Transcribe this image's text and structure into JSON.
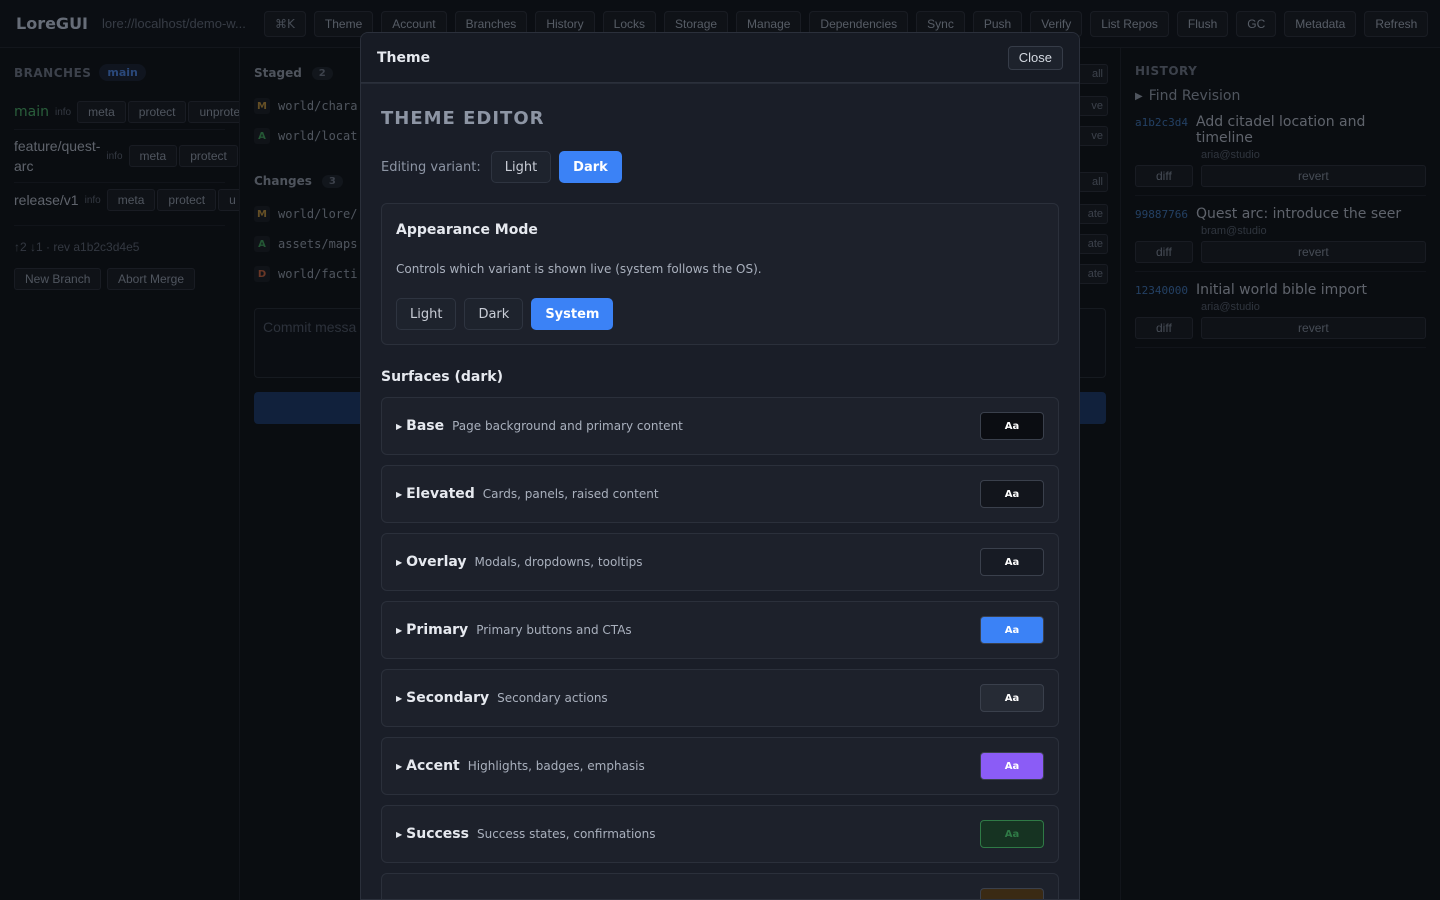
{
  "app": {
    "brand": "LoreGUI",
    "url": "lore://localhost/demo-w..."
  },
  "toolbar": {
    "kbd": "⌘K",
    "buttons": [
      "Theme",
      "Account",
      "Branches",
      "History",
      "Locks",
      "Storage",
      "Manage",
      "Dependencies",
      "Sync",
      "Push",
      "Verify",
      "List Repos",
      "Flush",
      "GC",
      "Metadata",
      "Refresh"
    ]
  },
  "branches": {
    "title": "BRANCHES",
    "current": "main",
    "info_label": "info",
    "items": [
      {
        "name": "main",
        "actions": [
          "meta",
          "protect",
          "unprote"
        ]
      },
      {
        "name": "feature/quest-arc",
        "actions": [
          "meta",
          "protect"
        ]
      },
      {
        "name": "release/v1",
        "actions": [
          "meta",
          "protect",
          "u"
        ]
      }
    ],
    "status": "↑2 ↓1 · rev a1b2c3d4e5",
    "new_branch": "New Branch",
    "abort_merge": "Abort Merge"
  },
  "staged": {
    "title": "Staged",
    "count": "2",
    "bulk": "all",
    "files": [
      {
        "status": "M",
        "path": "world/chara",
        "action": "ve"
      },
      {
        "status": "A",
        "path": "world/locat",
        "action": "ve"
      }
    ]
  },
  "changes": {
    "title": "Changes",
    "count": "3",
    "bulk": "all",
    "files": [
      {
        "status": "M",
        "path": "world/lore/",
        "action": "ate"
      },
      {
        "status": "A",
        "path": "assets/maps",
        "action": "ate"
      },
      {
        "status": "D",
        "path": "world/facti",
        "action": "ate"
      }
    ]
  },
  "commit": {
    "placeholder": "Commit messa"
  },
  "history": {
    "title": "HISTORY",
    "find": "Find Revision",
    "diff_label": "diff",
    "revert_label": "revert",
    "items": [
      {
        "hash": "a1b2c3d4",
        "message": "Add citadel location and timeline",
        "author": "aria@studio"
      },
      {
        "hash": "99887766",
        "message": "Quest arc: introduce the seer",
        "author": "bram@studio"
      },
      {
        "hash": "12340000",
        "message": "Initial world bible import",
        "author": "aria@studio"
      }
    ]
  },
  "modal": {
    "title": "Theme",
    "close": "Close",
    "editor_title": "THEME EDITOR",
    "variant_label": "Editing variant:",
    "variants": [
      "Light",
      "Dark"
    ],
    "variant_selected": "Dark",
    "appearance": {
      "title": "Appearance Mode",
      "description": "Controls which variant is shown live (system follows the OS).",
      "options": [
        "Light",
        "Dark",
        "System"
      ],
      "selected": "System"
    },
    "surfaces_title": "Surfaces (dark)",
    "surfaces": [
      {
        "name": "Base",
        "desc": "Page background and primary content",
        "sample": "Aa",
        "bg": "#0b0d12",
        "fg": "#ffffff"
      },
      {
        "name": "Elevated",
        "desc": "Cards, panels, raised content",
        "sample": "Aa",
        "bg": "#12151c",
        "fg": "#ffffff"
      },
      {
        "name": "Overlay",
        "desc": "Modals, dropdowns, tooltips",
        "sample": "Aa",
        "bg": "#171b24",
        "fg": "#ffffff"
      },
      {
        "name": "Primary",
        "desc": "Primary buttons and CTAs",
        "sample": "Aa",
        "bg": "#3b82f6",
        "fg": "#ffffff"
      },
      {
        "name": "Secondary",
        "desc": "Secondary actions",
        "sample": "Aa",
        "bg": "#262b35",
        "fg": "#ffffff"
      },
      {
        "name": "Accent",
        "desc": "Highlights, badges, emphasis",
        "sample": "Aa",
        "bg": "#8b5cf6",
        "fg": "#ffffff"
      },
      {
        "name": "Success",
        "desc": "Success states, confirmations",
        "sample": "Aa",
        "bg": "#163322",
        "fg": "#2f7a46"
      },
      {
        "name": "",
        "desc": "",
        "sample": "",
        "bg": "#3a2a14",
        "fg": "#c08a3c"
      }
    ]
  }
}
